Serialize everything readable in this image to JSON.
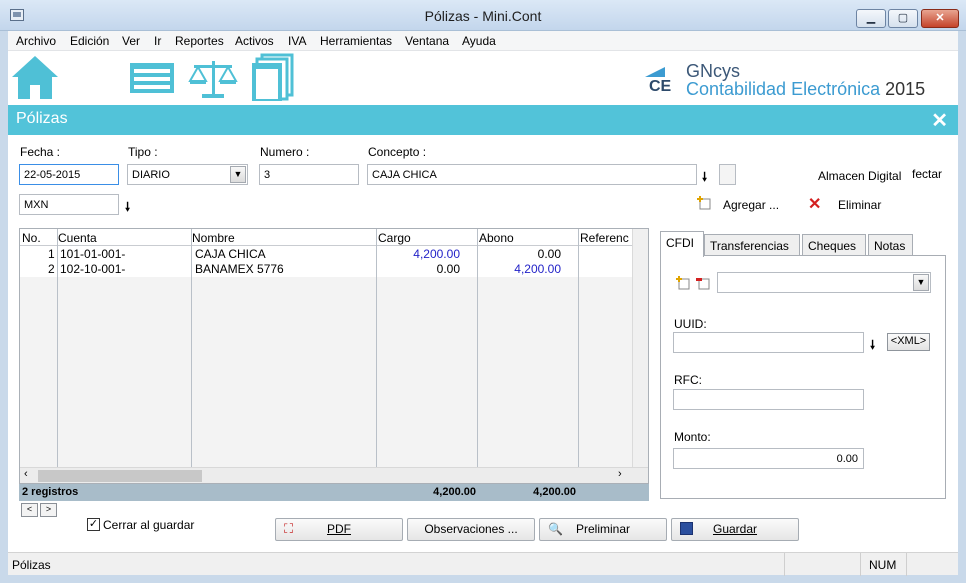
{
  "window": {
    "title": "Pólizas - Mini.Cont"
  },
  "menu": [
    "Archivo",
    "Edición",
    "Ver",
    "Ir",
    "Reportes",
    "Activos",
    "IVA",
    "Herramientas",
    "Ventana",
    "Ayuda"
  ],
  "brand": {
    "mark": "CE",
    "name": "GNcys",
    "subtitle": "Contabilidad Electrónica",
    "year": "2015"
  },
  "panel": {
    "title": "Pólizas"
  },
  "form": {
    "fecha_label": "Fecha :",
    "fecha_value": "22-05-2015",
    "tipo_label": "Tipo :",
    "tipo_value": "DIARIO",
    "numero_label": "Numero :",
    "numero_value": "3",
    "concepto_label": "Concepto :",
    "concepto_value": "CAJA CHICA",
    "moneda_value": "MXN",
    "almacen_label": "Almacen Digital",
    "fecha_label2": "fectar",
    "agregar_label": "Agregar ...",
    "eliminar_label": "Eliminar"
  },
  "grid": {
    "columns": [
      "No.",
      "Cuenta",
      "Nombre",
      "Cargo",
      "Abono",
      "Referenc"
    ],
    "rows": [
      {
        "no": "1",
        "cuenta": "101-01-001-",
        "nombre": "CAJA CHICA",
        "cargo": "4,200.00",
        "abono": "0.00"
      },
      {
        "no": "2",
        "cuenta": "102-10-001-",
        "nombre": "BANAMEX 5776",
        "cargo": "0.00",
        "abono": "4,200.00"
      }
    ],
    "totals": {
      "records": "2 registros",
      "cargo": "4,200.00",
      "abono": "4,200.00"
    }
  },
  "tabs": [
    "CFDI",
    "Transferencias",
    "Cheques",
    "Notas"
  ],
  "cfdi": {
    "uuid_label": "UUID:",
    "xml_button": "<XML>",
    "rfc_label": "RFC:",
    "monto_label": "Monto:",
    "monto_value": "0.00"
  },
  "footer": {
    "cerrar_label": "Cerrar al guardar",
    "pdf": "PDF",
    "observaciones": "Observaciones ...",
    "preliminar": "Preliminar",
    "guardar": "Guardar"
  },
  "status": {
    "text": "Pólizas",
    "num": "NUM"
  },
  "colors": {
    "accent": "#52c3d9",
    "totals": "#a8bcc9",
    "blue_value": "#2323c8"
  }
}
